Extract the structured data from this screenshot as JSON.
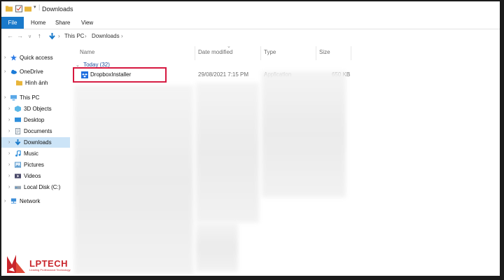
{
  "window": {
    "title": "Downloads"
  },
  "ribbon": {
    "tabs": [
      "File",
      "Home",
      "Share",
      "View"
    ]
  },
  "address": {
    "crumbs": [
      "This PC",
      "Downloads"
    ]
  },
  "nav": {
    "items": [
      {
        "label": "Quick access",
        "icon": "star-icon"
      },
      {
        "label": "OneDrive",
        "icon": "cloud-icon"
      },
      {
        "label": "Hình ảnh",
        "icon": "folder-icon"
      },
      {
        "label": "This PC",
        "icon": "computer-icon"
      },
      {
        "label": "3D Objects",
        "icon": "cube-icon"
      },
      {
        "label": "Desktop",
        "icon": "desktop-icon"
      },
      {
        "label": "Documents",
        "icon": "document-icon"
      },
      {
        "label": "Downloads",
        "icon": "download-icon",
        "selected": true
      },
      {
        "label": "Music",
        "icon": "music-icon"
      },
      {
        "label": "Pictures",
        "icon": "picture-icon"
      },
      {
        "label": "Videos",
        "icon": "video-icon"
      },
      {
        "label": "Local Disk (C:)",
        "icon": "disk-icon"
      },
      {
        "label": "Network",
        "icon": "network-icon"
      }
    ]
  },
  "files": {
    "columns": [
      "Name",
      "Date modified",
      "Type",
      "Size"
    ],
    "group": "Today (32)",
    "rows": [
      {
        "name": "DropboxInstaller",
        "date": "29/08/2021 7:15 PM",
        "type": "Application",
        "size": "650 KB"
      }
    ]
  },
  "logo": {
    "text": "LPTECH",
    "sub": "Leading Professional Technology"
  },
  "colors": {
    "accent": "#1979ca",
    "highlight": "#d6183f",
    "selected": "#cce4f7",
    "brand": "#c9252c"
  }
}
